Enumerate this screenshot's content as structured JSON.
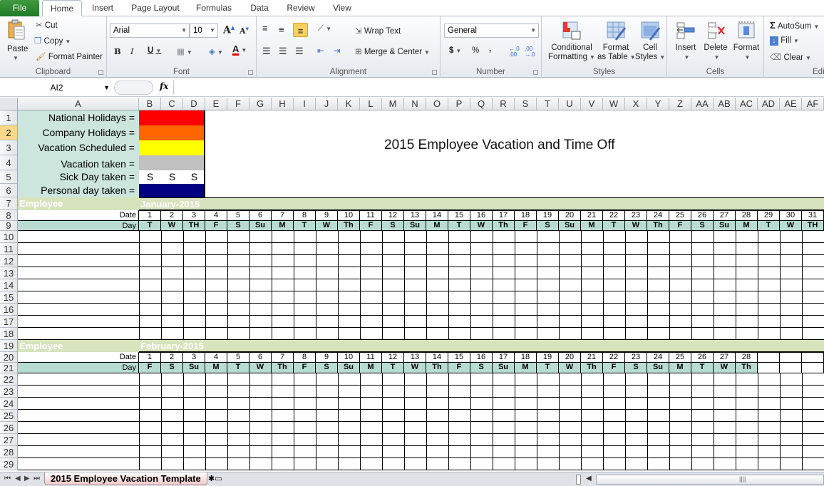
{
  "ribbon": {
    "tabs": [
      "File",
      "Home",
      "Insert",
      "Page Layout",
      "Formulas",
      "Data",
      "Review",
      "View"
    ],
    "active_tab": "Home",
    "clipboard": {
      "paste": "Paste",
      "cut": "Cut",
      "copy": "Copy",
      "format_painter": "Format Painter",
      "label": "Clipboard"
    },
    "font": {
      "name": "Arial",
      "size": "10",
      "bold": "B",
      "italic": "I",
      "underline": "U",
      "label": "Font"
    },
    "alignment": {
      "wrap_text": "Wrap Text",
      "merge_center": "Merge & Center",
      "label": "Alignment"
    },
    "number": {
      "format": "General",
      "currency": "$",
      "percent": "%",
      "comma": ",",
      "inc_decimal": "←.0 .00",
      "dec_decimal": ".00 →.0",
      "label": "Number"
    },
    "styles": {
      "conditional": "Conditional",
      "conditional2": "Formatting",
      "format_table": "Format",
      "format_table2": "as Table",
      "cell_styles": "Cell",
      "cell_styles2": "Styles",
      "label": "Styles"
    },
    "cells": {
      "insert": "Insert",
      "delete": "Delete",
      "format": "Format",
      "label": "Cells"
    },
    "editing": {
      "autosum": "AutoSum",
      "fill": "Fill",
      "clear": "Clear",
      "label": "Edi"
    }
  },
  "formula_bar": {
    "name_box": "AI2",
    "fx": "fx",
    "value": ""
  },
  "columns": [
    "A",
    "B",
    "C",
    "D",
    "E",
    "F",
    "G",
    "H",
    "I",
    "J",
    "K",
    "L",
    "M",
    "N",
    "O",
    "P",
    "Q",
    "R",
    "S",
    "T",
    "U",
    "V",
    "W",
    "X",
    "Y",
    "Z",
    "AA",
    "AB",
    "AC",
    "AD",
    "AE",
    "AF"
  ],
  "rows": [
    "1",
    "2",
    "3",
    "4",
    "5",
    "6",
    "7",
    "8",
    "9",
    "10",
    "11",
    "12",
    "13",
    "14",
    "15",
    "16",
    "17",
    "18",
    "19",
    "20",
    "21",
    "22",
    "23",
    "24",
    "25",
    "26",
    "27",
    "28",
    "29"
  ],
  "selected_row": "2",
  "legend": [
    {
      "label": "National Holidays =",
      "color": "#ff0000",
      "mark": ""
    },
    {
      "label": "Company Holidays =",
      "color": "#ff6600",
      "mark": ""
    },
    {
      "label": "Vacation Scheduled =",
      "color": "#ffff00",
      "mark": ""
    },
    {
      "label": "Vacation taken =",
      "color": "#c0c0c0",
      "mark": ""
    },
    {
      "label": "Sick Day taken =",
      "color": "#ffffff",
      "mark": "S"
    },
    {
      "label": "Personal day taken =",
      "color": "#000080",
      "mark": ""
    }
  ],
  "sheet_title": "2015 Employee Vacation and Time Off",
  "employee_header": "Employee",
  "date_label": "Date",
  "day_label": "Day",
  "months": [
    {
      "name": "January-2015",
      "dates": [
        "1",
        "2",
        "3",
        "4",
        "5",
        "6",
        "7",
        "8",
        "9",
        "10",
        "11",
        "12",
        "13",
        "14",
        "15",
        "16",
        "17",
        "18",
        "19",
        "20",
        "21",
        "22",
        "23",
        "24",
        "25",
        "26",
        "27",
        "28",
        "29",
        "30",
        "31"
      ],
      "days": [
        "T",
        "W",
        "TH",
        "F",
        "S",
        "Su",
        "M",
        "T",
        "W",
        "Th",
        "F",
        "S",
        "Su",
        "M",
        "T",
        "W",
        "Th",
        "F",
        "S",
        "Su",
        "M",
        "T",
        "W",
        "Th",
        "F",
        "S",
        "Su",
        "M",
        "T",
        "W",
        "TH"
      ]
    },
    {
      "name": "February-2015",
      "dates": [
        "1",
        "2",
        "3",
        "4",
        "5",
        "6",
        "7",
        "8",
        "9",
        "10",
        "11",
        "12",
        "13",
        "14",
        "15",
        "16",
        "17",
        "18",
        "19",
        "20",
        "21",
        "22",
        "23",
        "24",
        "25",
        "26",
        "27",
        "28"
      ],
      "days": [
        "F",
        "S",
        "Su",
        "M",
        "T",
        "W",
        "Th",
        "F",
        "S",
        "Su",
        "M",
        "T",
        "W",
        "Th",
        "F",
        "S",
        "Su",
        "M",
        "T",
        "W",
        "Th",
        "F",
        "S",
        "Su",
        "M",
        "T",
        "W",
        "Th"
      ]
    }
  ],
  "sheet_tabs": [
    {
      "name": "2015 Employee Vacation Template",
      "active": true
    }
  ],
  "colors": {
    "legend_bg": "#cce5dd",
    "month_band": "#d7e3bc",
    "day_row": "#b9dcd2"
  }
}
